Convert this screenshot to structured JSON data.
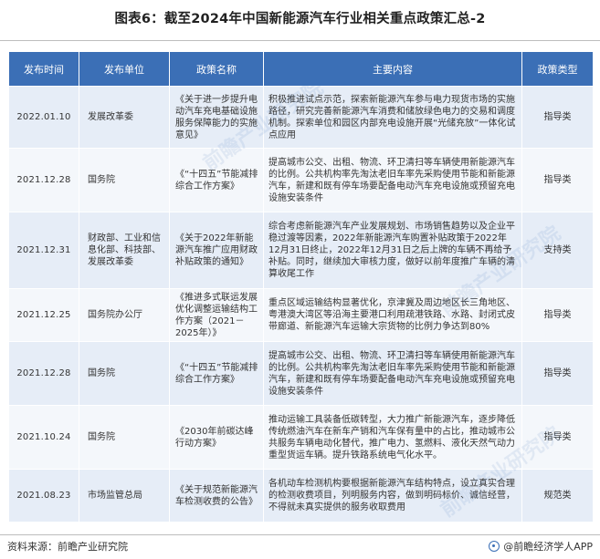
{
  "title": "图表6：截至2024年中国新能源汽车行业相关重点政策汇总-2",
  "table": {
    "headers": [
      "发布时间",
      "发布单位",
      "政策名称",
      "主要内容",
      "政策类型"
    ],
    "rows": [
      {
        "date": "2022.01.10",
        "org": "发展改革委",
        "name": "《关于进一步提升电动汽车充电基础设施服务保障能力的实施意见》",
        "content": "积极推进试点示范，探索新能源汽车参与电力现货市场的实施路径，研究完善新能源汽车消费和储放绿色电力的交易和调度机制。探索单位和园区内部充电设施开展“光储充放”一体化试点应用",
        "type": "指导类"
      },
      {
        "date": "2021.12.28",
        "org": "国务院",
        "name": "《“十四五”节能减排综合工作方案》",
        "content": "提高城市公交、出租、物流、环卫清扫等车辆使用新能源汽车的比例。公共机构率先淘汰老旧车率先采购使用节能和新能源汽车，新建和既有停车场要配备电动汽车充电设施或预留充电设施安装条件",
        "type": "指导类"
      },
      {
        "date": "2021.12.31",
        "org": "财政部、工业和信息化部、科技部、发展改革委",
        "name": "《关于2022年新能源汽车推广应用财政补贴政策的通知》",
        "content": "综合考虑新能源汽车产业发展规划、市场销售趋势以及企业平稳过渡等因素，2022年新能源汽车购置补贴政策于2022年12月31日终止，2022年12月31日之后上牌的车辆不再给予补贴。同时，继续加大审核力度，做好以前年度推广车辆的清算收尾工作",
        "type": "支持类"
      },
      {
        "date": "2021.12.25",
        "org": "国务院办公厅",
        "name": "《推进多式联运发展优化调整运输结构工作方案（2021－2025年）》",
        "content": "重点区域运输结构显著优化，京津冀及周边地区长三角地区、粤港澳大湾区等沿海主要港口利用疏港铁路、水路、封闭式皮带廊道、新能源汽车运输大宗货物的比例力争达到80%",
        "type": "指导类"
      },
      {
        "date": "2021.12.28",
        "org": "国务院",
        "name": "《“十四五”节能减排综合工作方案》",
        "content": "提高城市公交、出租、物流、环卫清扫等车辆使用新能源汽车的比例。公共机构率先淘汰老旧车率先采购使用节能和新能源汽车，新建和既有停车场要配备电动汽车充电设施或预留充电设施安装条件",
        "type": "指导类"
      },
      {
        "date": "2021.10.24",
        "org": "国务院",
        "name": "《2030年前碳达峰行动方案》",
        "content": "推动运输工具装备低碳转型，大力推广新能源汽车，逐步降低传统燃油汽车在新车产销和汽车保有量中的占比，推动城市公共服务车辆电动化替代，推广电力、氢燃料、液化天然气动力重型货运车辆。提升铁路系统电气化水平。",
        "type": "指导类"
      },
      {
        "date": "2021.08.23",
        "org": "市场监管总局",
        "name": "《关于规范新能源汽车检测收费的公告》",
        "content": "各机动车检测机构要根据新能源汽车结构特点，设立真实合理的检测收费项目，列明服务内容，做到明码标价、诚信经营，不得就未真实提供的服务收取费用",
        "type": "规范类"
      }
    ]
  },
  "footer": {
    "source": "资料来源：前瞻产业研究院",
    "brand": "@前瞻经济学人APP"
  },
  "watermark": "前瞻产业研究院",
  "colors": {
    "header_bg": "#3b6fb6",
    "row_odd": "#e6edf7",
    "row_even": "#f4f7fb"
  }
}
